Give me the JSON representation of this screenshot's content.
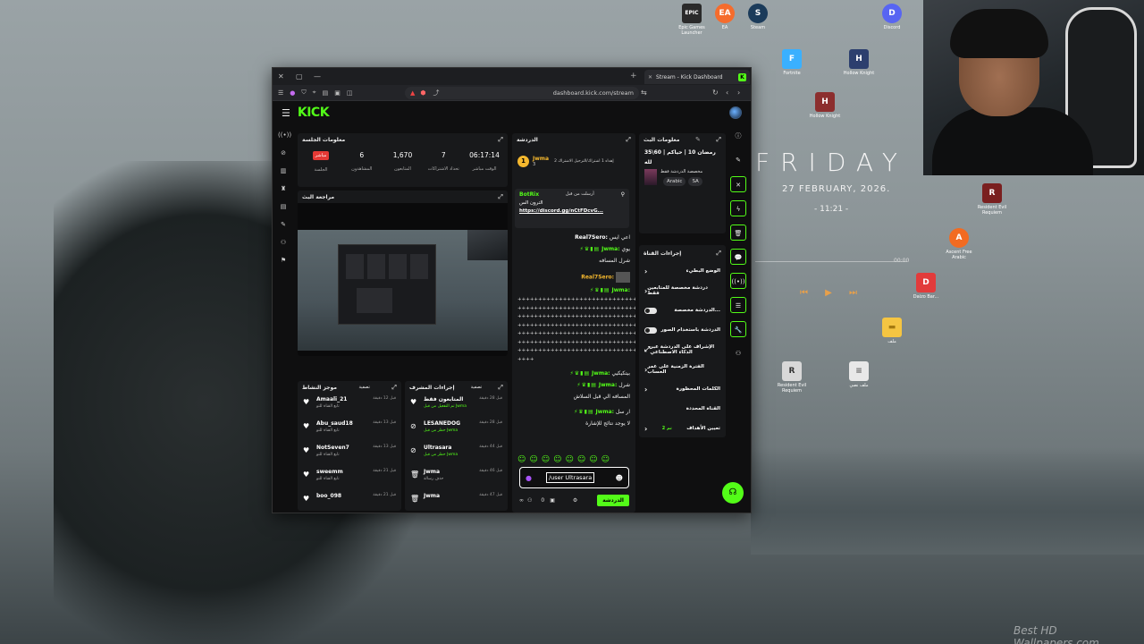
{
  "desktop": {
    "clock": {
      "day": "FRIDAY",
      "date": "27 FEBRUARY, 2026.",
      "time": "- 11:21 -"
    },
    "media": {
      "time": "00:00",
      "controls": "⏮ ▶ ⏭"
    },
    "icons": [
      {
        "label": "Epic Games Launcher",
        "glyph": "EPIC",
        "color": "#2a2a2a"
      },
      {
        "label": "EA",
        "glyph": "EA",
        "color": "#f56c2d"
      },
      {
        "label": "Steam",
        "glyph": "S",
        "color": "#1b3b5a"
      },
      {
        "label": "Discord",
        "glyph": "D",
        "color": "#5865f2"
      },
      {
        "label": "Fortnite",
        "glyph": "F",
        "color": "#3ab0ff"
      },
      {
        "label": "Hollow Knight",
        "glyph": "H",
        "color": "#2c3f6e"
      },
      {
        "label": "Hollow Knight",
        "glyph": "H",
        "color": "#8c2e2e"
      },
      {
        "label": "Resident Evil Requiem",
        "glyph": "R",
        "color": "#7a1f1f"
      },
      {
        "label": "Resident Evil Requiem",
        "glyph": "R",
        "color": "#d8d8d8"
      },
      {
        "label": "Ascent Free Arabic",
        "glyph": "A",
        "color": "#f26b21"
      },
      {
        "label": "Daizo Bar...",
        "glyph": "D",
        "color": "#e23b3b"
      },
      {
        "label": "ملف",
        "glyph": "▬",
        "color": "#f5c542"
      },
      {
        "label": "ملف نصي",
        "glyph": "≡",
        "color": "#e8e8e8"
      }
    ],
    "watermark": "Best HD Wallpapers.com"
  },
  "browser": {
    "tab_title": "Stream - Kick Dashboard",
    "url": "dashboard.kick.com/stream"
  },
  "kick": {
    "logo": "KICK",
    "session": {
      "title": "معلومات الجلسة",
      "live": "مباشر",
      "stats": [
        {
          "value": "06:17:14",
          "label": "الوقت مباشر"
        },
        {
          "value": "7",
          "label": "تحداد الاشتراكات"
        },
        {
          "value": "1,670",
          "label": "المتابعون"
        },
        {
          "value": "6",
          "label": "المشاهدون"
        },
        {
          "value": "",
          "label": "الجلسة"
        }
      ]
    },
    "preview_title": "مراجعة البث",
    "activity": {
      "title": "موجز النشاط",
      "filter": "تصفية",
      "items": [
        {
          "name": "Amaali_21",
          "sub": "تابع القناة للتو",
          "time": "قبل 12 دقيقة",
          "icon": "♥"
        },
        {
          "name": "Abu_saud18",
          "sub": "تابع القناة للتو",
          "time": "قبل 13 دقيقة",
          "icon": "♥"
        },
        {
          "name": "NotSeven7",
          "sub": "تابع القناة للتو",
          "time": "قبل 13 دقيقة",
          "icon": "♥"
        },
        {
          "name": "sweemm",
          "sub": "تابع القناة للتو",
          "time": "قبل 21 دقيقة",
          "icon": "♥"
        },
        {
          "name": "boo_098",
          "sub": "",
          "time": "قبل 21 دقيقة",
          "icon": "♥"
        }
      ]
    },
    "mod_actions": {
      "title": "إجراءات المشرف",
      "filter": "تصفية",
      "items": [
        {
          "name": "المتابعون فقط",
          "sub": "تم التفعيل من قبل Jwma",
          "time": "قبل 28 دقيقة",
          "icon": "♥"
        },
        {
          "name": "LESANEDOG",
          "sub": "حظر من قبل Jwma",
          "time": "قبل 28 دقيقة",
          "icon": "⊘"
        },
        {
          "name": "Ultrasara",
          "sub": "حظر من قبل Jwma",
          "time": "قبل 44 دقيقة",
          "icon": "⊘"
        },
        {
          "name": "Jwma",
          "sub": "حذف رسالة",
          "time": "قبل 46 دقيقة",
          "icon": "🗑"
        },
        {
          "name": "Jwma",
          "sub": "",
          "time": "قبل 47 دقيقة",
          "icon": "🗑"
        }
      ]
    },
    "chat": {
      "title": "الدردشة",
      "top_user": "Jwma",
      "top_count": "3",
      "top_text": "إهداء 1 اشتراك/الترحيل الاشتراك 2",
      "pinned_by": "أرسلت من قبل",
      "pinned_user": "BotRix",
      "pinned_text": "الترون الس",
      "pinned_link": "https://discord.gg/nCtFDcvG...",
      "messages": [
        {
          "user": "Real7Sero:",
          "text": "اعي ايس"
        },
        {
          "user": "Jwma:",
          "text": "يوي"
        },
        {
          "user": "",
          "text": "شرل المسافه"
        },
        {
          "user": "Real7Sero:",
          "text": ""
        },
        {
          "user": "Jwma:",
          "text": ""
        }
      ],
      "hash_rows": [
        "++++++++++++++++++++++++++++++++++++++++",
        "++++++++++++++++++++++++++++++++++++++++",
        "++++++++++++++++++++++++++++++++++++++++",
        "++++++++++++++++++++++++++++++++++++++++",
        "++++++++++++++++++++++++++++++++++++++++",
        "++++++++++++++++++++++++++++++++++++++++",
        "++++++++++++++++++++++++++++++++++++++++",
        "++++"
      ],
      "after": [
        {
          "user": "Jwma:",
          "text": "بيتكيكيي"
        },
        {
          "user": "Jwma:",
          "text": "شرل"
        },
        {
          "user": "",
          "text": "المسافه الي قبل السلاش"
        },
        {
          "user": "Jwma:",
          "text": "ار سل"
        },
        {
          "user": "",
          "text": "لا يوجد نتائج للإشارة"
        }
      ],
      "input_value": "/user Ultrasara",
      "count": "0",
      "send": "الدردشة"
    },
    "stream_info": {
      "title": "معلومات البث",
      "line1": "رمضان 10 | حياكم | 60\\35",
      "line2": "مخصصة الدردشة فقط",
      "line3": "لله",
      "tags": [
        "SA",
        "Arabic"
      ]
    },
    "channel_actions": {
      "title": "إجراءات القناة",
      "rows": [
        {
          "label": "الوضع البطيء",
          "ctrl": "chev"
        },
        {
          "label": "دردشة مخصصة للمتابعين فقط",
          "sub": "1 د",
          "ctrl": "chev"
        },
        {
          "label": "الدردشة مخصصة...",
          "ctrl": "toggle"
        },
        {
          "label": "الدردشة باستخدام الصور",
          "ctrl": "toggle"
        },
        {
          "label": "الإشراف على الدردشة عبر الذكاء الاصطناعي",
          "ctrl": "ext"
        },
        {
          "label": "الفترة الزمنية على عمر الحساب",
          "ctrl": "chev"
        },
        {
          "label": "الكلمات المحظورة",
          "ctrl": "chev"
        },
        {
          "label": "القناة المحددة",
          "ctrl": ""
        },
        {
          "label": "تعيين الأهداف",
          "sub": "تم 2",
          "ctrl": "chev"
        }
      ]
    }
  }
}
